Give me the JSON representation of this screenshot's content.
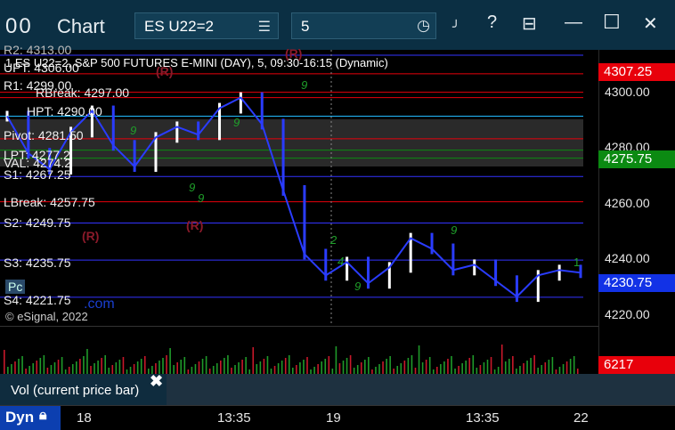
{
  "window": {
    "icon_text": "00",
    "title": "Chart",
    "symbol": "ES U22=2",
    "interval": "5",
    "list_icon": "list-icon",
    "clock_icon": "clock-icon",
    "help_label": "?",
    "icons": [
      "export-icon",
      "minimize-icon",
      "maximize-icon",
      "close-icon"
    ]
  },
  "chart": {
    "header": "ES U22=2, S&P 500 FUTURES E-MINI (DAY), 5, 09:30-16:15 (Dynamic)",
    "header_partial": "1",
    "copyright": "© eSignal, 2022",
    "watermark": ".com",
    "watermark2": "Pc",
    "price_ticks": [
      "4300.00",
      "4280.00",
      "4260.00",
      "4240.00",
      "4220.00"
    ],
    "price_boxes": [
      {
        "label": "4307.25",
        "color": "#e8000b"
      },
      {
        "label": "4275.75",
        "color": "#0b8a12"
      },
      {
        "label": "4230.75",
        "color": "#1232e6"
      }
    ],
    "levels": [
      {
        "label": "R2: 4313.00"
      },
      {
        "label": "UPT: 4306.00"
      },
      {
        "label": "R1: 4299.00"
      },
      {
        "label": "RBreak: 4297.00"
      },
      {
        "label": "HPT: 4290.00"
      },
      {
        "label": "Pivot: 4281.50"
      },
      {
        "label": "LPT: 4277.2"
      },
      {
        "label": "VAL: 4274.2"
      },
      {
        "label": "S1: 4267.25"
      },
      {
        "label": "LBreak: 4257.75"
      },
      {
        "label": "S2: 4249.75"
      },
      {
        "label": "S3: 4235.75"
      },
      {
        "label": "S4: 4221.75"
      }
    ],
    "r_markers": [
      "(R)",
      "(R)",
      "(R)",
      "(R)"
    ],
    "time_labels": [
      "18",
      "13:35",
      "19",
      "13:35",
      "22"
    ],
    "volume_box": {
      "label": "6217",
      "color": "#e8000b"
    },
    "volume_label": "Vol (current price bar)",
    "close_label": "✖",
    "dyn_label": "Dyn",
    "lock_icon": "lock-icon",
    "count_labels": [
      "9",
      "9",
      "9",
      "9",
      "9",
      "9",
      "2",
      "4",
      "9",
      "1"
    ]
  },
  "chart_data": {
    "type": "line",
    "title": "ES U22=2, S&P 500 FUTURES E-MINI (DAY), 5, 09:30-16:15 (Dynamic)",
    "xlabel": "",
    "ylabel": "",
    "ylim": [
      4215,
      4315
    ],
    "x": [
      "18",
      "13:35",
      "19",
      "13:35",
      "22"
    ],
    "series": [
      {
        "name": "",
        "values": [
          4290,
          4276,
          4270,
          4284,
          4292,
          4279,
          4271,
          4282,
          4286,
          4283,
          4293,
          4297,
          4287,
          4262,
          4238,
          4230,
          4235,
          4227,
          4233,
          4244,
          4240,
          4232,
          4234,
          4228,
          4222,
          4230,
          4232,
          4231
        ]
      }
    ],
    "levels": [
      4313.0,
      4306.0,
      4299.0,
      4297.0,
      4290.0,
      4281.5,
      4277.2,
      4274.2,
      4267.25,
      4257.75,
      4249.75,
      4235.75,
      4221.75
    ],
    "last_price": 4230.75,
    "volume_last": 6217
  }
}
